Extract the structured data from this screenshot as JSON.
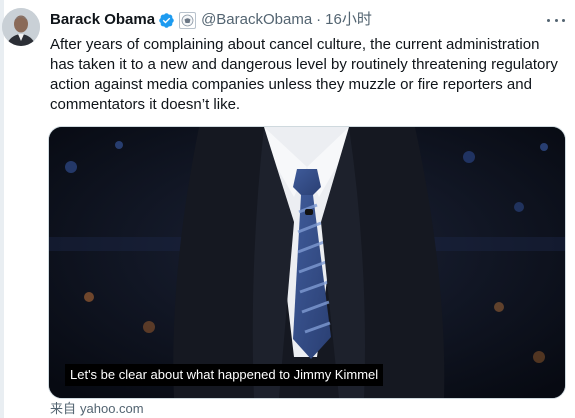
{
  "tweet": {
    "author_name": "Barack Obama",
    "handle": "@BarackObama",
    "separator": "·",
    "time": "16小时",
    "text_lines": [
      "After years of complaining about cancel culture, the current administration",
      "has taken it to a new and dangerous level by routinely threatening regulatory",
      "action against media companies unless they muzzle or fire reporters and",
      "commentators it doesn’t like."
    ],
    "media": {
      "caption": "Let's be clear about what happened to Jimmy Kimmel"
    },
    "source": {
      "label": "来自",
      "domain": "yahoo.com"
    }
  },
  "colors": {
    "verified": "#1d9bf0",
    "text": "#0f1419",
    "secondary": "#536471"
  },
  "icons": [
    "verified-badge-icon",
    "government-seal-icon",
    "more-options-icon"
  ]
}
